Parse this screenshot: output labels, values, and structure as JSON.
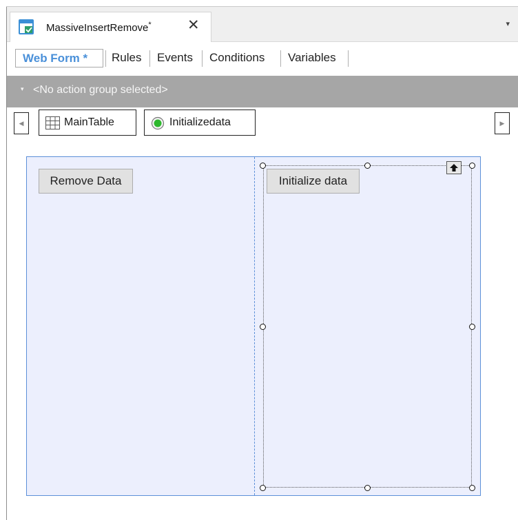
{
  "document_tab": {
    "title": "MassiveInsertRemove",
    "modified_marker": "*",
    "close_glyph": "✕",
    "icon": "webpanel-icon"
  },
  "tabstrip": {
    "overflow_glyph": "▾"
  },
  "subtabs": [
    "Web Form *",
    "Rules",
    "Events",
    "Conditions",
    "Variables"
  ],
  "action_group": {
    "caret": "▾",
    "label": "<No action group selected>"
  },
  "breadcrumb": {
    "scroll_left_glyph": "◀",
    "scroll_right_glyph": "▶",
    "items": [
      {
        "label": "MainTable",
        "icon": "table-grid-icon"
      },
      {
        "label": "Initializedata",
        "icon": "green-radio-icon"
      }
    ]
  },
  "form": {
    "remove_button": "Remove Data",
    "initialize_button": "Initialize data",
    "select_parent_icon": "arrow-up-icon"
  },
  "colors": {
    "accent": "#4a90d9",
    "action_bar": "#a6a6a6",
    "form_background": "#eceffd",
    "form_border": "#5b8fd8",
    "status_green": "#2db82d"
  }
}
